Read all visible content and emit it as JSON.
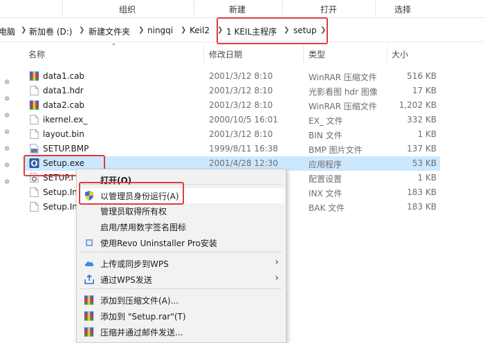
{
  "ribbon": {
    "groups": [
      "组织",
      "新建",
      "打开",
      "选择"
    ]
  },
  "address": {
    "crumbs": [
      "电脑",
      "新加卷 (D:)",
      "新建文件夹",
      "ningqi",
      "Keil2",
      "1 KEIL主程序",
      "setup"
    ]
  },
  "columns": {
    "name": "名称",
    "date": "修改日期",
    "type": "类型",
    "size": "大小"
  },
  "files": [
    {
      "name": "data1.cab",
      "date": "2001/3/12 8:10",
      "type": "WinRAR 压缩文件",
      "size": "516 KB",
      "icon": "rar-icon"
    },
    {
      "name": "data1.hdr",
      "date": "2001/3/12 8:10",
      "type": "光影看图 hdr 图像",
      "size": "17 KB",
      "icon": "file-icon"
    },
    {
      "name": "data2.cab",
      "date": "2001/3/12 8:10",
      "type": "WinRAR 压缩文件",
      "size": "1,202 KB",
      "icon": "rar-icon"
    },
    {
      "name": "ikernel.ex_",
      "date": "2000/10/5 16:01",
      "type": "EX_ 文件",
      "size": "332 KB",
      "icon": "file-icon"
    },
    {
      "name": "layout.bin",
      "date": "2001/3/12 8:10",
      "type": "BIN 文件",
      "size": "1 KB",
      "icon": "file-icon"
    },
    {
      "name": "SETUP.BMP",
      "date": "1999/8/11 16:38",
      "type": "BMP 图片文件",
      "size": "137 KB",
      "icon": "bmp-icon"
    },
    {
      "name": "Setup.exe",
      "date": "2001/4/28 12:30",
      "type": "应用程序",
      "size": "53 KB",
      "icon": "setup-exe-icon"
    },
    {
      "name": "SETUP.I",
      "date": "",
      "type": "配置设置",
      "size": "1 KB",
      "icon": "ini-icon"
    },
    {
      "name": "Setup.In",
      "date": "",
      "type": "INX 文件",
      "size": "183 KB",
      "icon": "file-icon"
    },
    {
      "name": "Setup.In",
      "date": "",
      "type": "BAK 文件",
      "size": "183 KB",
      "icon": "file-icon"
    }
  ],
  "menu": {
    "items": [
      {
        "label": "打开(O)",
        "icon": "",
        "arrow": false,
        "highlight": false,
        "bold": true
      },
      {
        "label": "以管理员身份运行(A)",
        "icon": "uac-shield-icon",
        "arrow": false,
        "highlight": true,
        "bold": false
      },
      {
        "label": "管理员取得所有权",
        "icon": "",
        "arrow": false,
        "highlight": false,
        "bold": false
      },
      {
        "label": "启用/禁用数字签名图标",
        "icon": "",
        "arrow": false,
        "highlight": false,
        "bold": false
      },
      {
        "label": "使用Revo Uninstaller Pro安装",
        "icon": "revo-icon",
        "arrow": false,
        "highlight": false,
        "bold": false
      },
      {
        "label": "上传或同步到WPS",
        "icon": "cloud-icon",
        "arrow": true,
        "highlight": false,
        "bold": false
      },
      {
        "label": "通过WPS发送",
        "icon": "share-icon",
        "arrow": true,
        "highlight": false,
        "bold": false
      },
      {
        "label": "添加到压缩文件(A)...",
        "icon": "rar-icon",
        "arrow": false,
        "highlight": false,
        "bold": false
      },
      {
        "label": "添加到 \"Setup.rar\"(T)",
        "icon": "rar-icon",
        "arrow": false,
        "highlight": false,
        "bold": false
      },
      {
        "label": "压缩并通过邮件发送...",
        "icon": "rar-icon",
        "arrow": false,
        "highlight": false,
        "bold": false
      }
    ]
  },
  "colors": {
    "selection": "#cce8ff",
    "annotation": "#e23a3a",
    "menu_bg": "#f2f2f2"
  }
}
